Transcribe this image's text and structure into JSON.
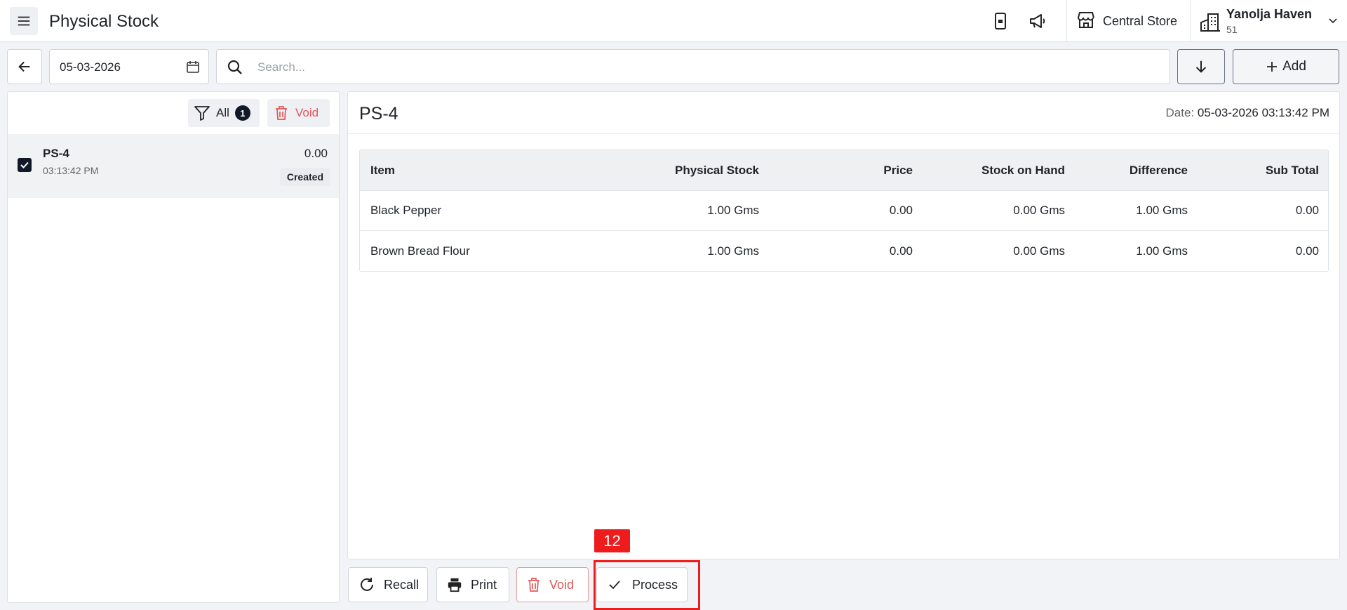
{
  "header": {
    "title": "Physical Stock",
    "store": "Central Store",
    "property_name": "Yanolja Haven",
    "property_number": "51"
  },
  "toolbar": {
    "date": "05-03-2026",
    "search_placeholder": "Search...",
    "add_label": "Add"
  },
  "list": {
    "filter_label": "All",
    "filter_count": "1",
    "void_label": "Void",
    "items": [
      {
        "code": "PS-4",
        "time": "03:13:42 PM",
        "amount": "0.00",
        "status": "Created",
        "checked": true
      }
    ]
  },
  "detail": {
    "title": "PS-4",
    "date_label": "Date:",
    "date_value": "05-03-2026 03:13:42 PM",
    "columns": [
      "Item",
      "Physical Stock",
      "Price",
      "Stock on Hand",
      "Difference",
      "Sub Total"
    ],
    "rows": [
      [
        "Black Pepper",
        "1.00 Gms",
        "0.00",
        "0.00 Gms",
        "1.00 Gms",
        "0.00"
      ],
      [
        "Brown Bread Flour",
        "1.00 Gms",
        "0.00",
        "0.00 Gms",
        "1.00 Gms",
        "0.00"
      ]
    ]
  },
  "actions": {
    "recall": "Recall",
    "print": "Print",
    "void": "Void",
    "process": "Process"
  },
  "annotation": {
    "tag": "12",
    "color": "#ee1c1c"
  },
  "colors": {
    "void": "#e15759",
    "dark": "#111827"
  }
}
